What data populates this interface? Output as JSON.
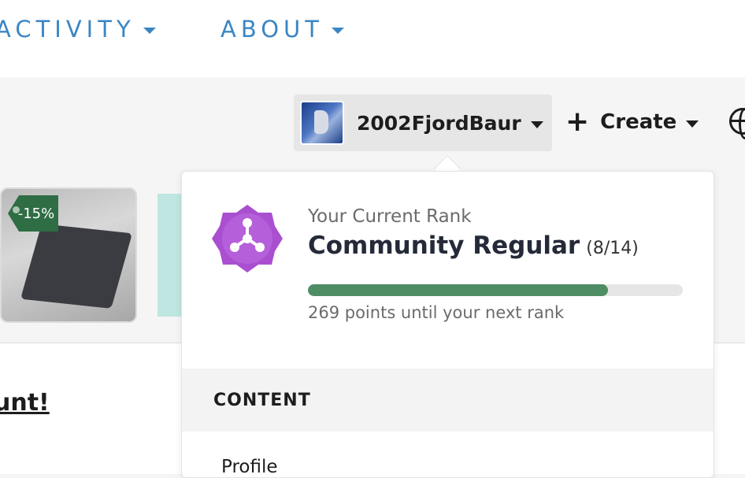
{
  "nav": {
    "items": [
      {
        "label": "ACTIVITY"
      },
      {
        "label": "ABOUT"
      }
    ]
  },
  "user": {
    "username": "2002FjordBaur",
    "avatar_icon": "user-avatar"
  },
  "toolbar": {
    "create_label": "Create",
    "globe_icon": "globe-icon"
  },
  "product": {
    "discount_label": "-15%"
  },
  "page": {
    "link_text": "unt!"
  },
  "rank": {
    "caption": "Your Current Rank",
    "title": "Community Regular",
    "count": "(8/14)",
    "progress_fraction": 0.8,
    "points_text": "269 points until your next rank",
    "badge_color": "#a94fd0"
  },
  "menu": {
    "section_header": "CONTENT",
    "items": [
      {
        "label": "Profile"
      }
    ]
  },
  "colors": {
    "accent_blue": "#3a86c4",
    "progress_green": "#4f8d65"
  }
}
